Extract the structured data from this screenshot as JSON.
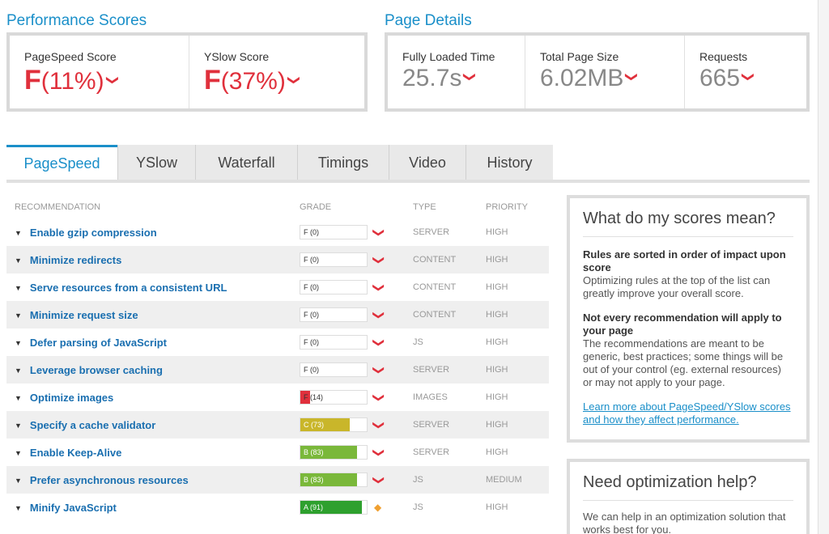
{
  "performance": {
    "title": "Performance Scores",
    "pagespeed": {
      "label": "PageSpeed Score",
      "grade": "F",
      "percent": "(11%)"
    },
    "yslow": {
      "label": "YSlow Score",
      "grade": "F",
      "percent": "(37%)"
    }
  },
  "details": {
    "title": "Page Details",
    "load_time": {
      "label": "Fully Loaded Time",
      "value": "25.7s"
    },
    "page_size": {
      "label": "Total Page Size",
      "value": "6.02MB"
    },
    "requests": {
      "label": "Requests",
      "value": "665"
    }
  },
  "tabs": [
    {
      "label": "PageSpeed",
      "active": true
    },
    {
      "label": "YSlow"
    },
    {
      "label": "Waterfall"
    },
    {
      "label": "Timings"
    },
    {
      "label": "Video"
    },
    {
      "label": "History"
    }
  ],
  "table": {
    "headers": {
      "rec": "RECOMMENDATION",
      "grade": "GRADE",
      "type": "TYPE",
      "priority": "PRIORITY"
    },
    "rows": [
      {
        "rec": "Enable gzip compression",
        "grade": "F (0)",
        "score": 0,
        "type": "SERVER",
        "priority": "HIGH",
        "icon": "chevron-down-icon"
      },
      {
        "rec": "Minimize redirects",
        "grade": "F (0)",
        "score": 0,
        "type": "CONTENT",
        "priority": "HIGH",
        "icon": "chevron-down-icon"
      },
      {
        "rec": "Serve resources from a consistent URL",
        "grade": "F (0)",
        "score": 0,
        "type": "CONTENT",
        "priority": "HIGH",
        "icon": "chevron-down-icon"
      },
      {
        "rec": "Minimize request size",
        "grade": "F (0)",
        "score": 0,
        "type": "CONTENT",
        "priority": "HIGH",
        "icon": "chevron-down-icon"
      },
      {
        "rec": "Defer parsing of JavaScript",
        "grade": "F (0)",
        "score": 0,
        "type": "JS",
        "priority": "HIGH",
        "icon": "chevron-down-icon"
      },
      {
        "rec": "Leverage browser caching",
        "grade": "F (0)",
        "score": 0,
        "type": "SERVER",
        "priority": "HIGH",
        "icon": "chevron-down-icon"
      },
      {
        "rec": "Optimize images",
        "grade": "F (14)",
        "score": 14,
        "type": "IMAGES",
        "priority": "HIGH",
        "icon": "chevron-down-icon"
      },
      {
        "rec": "Specify a cache validator",
        "grade": "C (73)",
        "score": 73,
        "type": "SERVER",
        "priority": "HIGH",
        "icon": "chevron-down-icon"
      },
      {
        "rec": "Enable Keep-Alive",
        "grade": "B (83)",
        "score": 83,
        "type": "SERVER",
        "priority": "HIGH",
        "icon": "chevron-down-icon"
      },
      {
        "rec": "Prefer asynchronous resources",
        "grade": "B (83)",
        "score": 83,
        "type": "JS",
        "priority": "MEDIUM",
        "icon": "chevron-down-icon"
      },
      {
        "rec": "Minify JavaScript",
        "grade": "A (91)",
        "score": 91,
        "type": "JS",
        "priority": "HIGH",
        "icon": "diamond-icon"
      }
    ]
  },
  "colors": {
    "F": "#e0303c",
    "C": "#c9b62a",
    "B": "#7ab83a",
    "A": "#2ea02e"
  },
  "sidebar": {
    "scores_box": {
      "title": "What do my scores mean?",
      "h1": "Rules are sorted in order of impact upon score",
      "p1": "Optimizing rules at the top of the list can greatly improve your overall score.",
      "h2": "Not every recommendation will apply to your page",
      "p2": "The recommendations are meant to be generic, best practices; some things will be out of your control (eg. external resources) or may not apply to your page.",
      "link": "Learn more about PageSpeed/YSlow scores and how they affect performance."
    },
    "help_box": {
      "title": "Need optimization help?",
      "p1": "We can help in an optimization solution that works best for you."
    }
  }
}
